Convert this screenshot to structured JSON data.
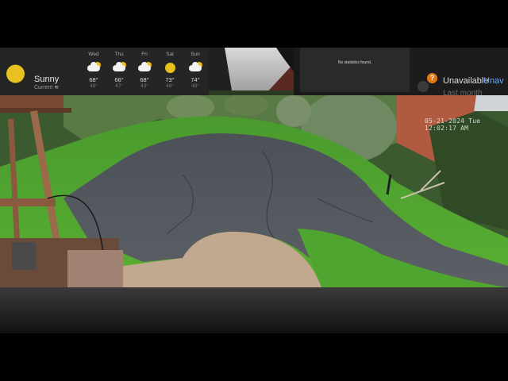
{
  "weather": {
    "current": {
      "condition": "Sunny",
      "label": "Current",
      "icon": "sun-icon",
      "wind_icon": "wind-icon"
    },
    "forecast": [
      {
        "day": "Wed",
        "high": "68°",
        "low": "48°",
        "icon": "partly-cloudy-icon"
      },
      {
        "day": "Thu",
        "high": "66°",
        "low": "47°",
        "icon": "partly-cloudy-icon"
      },
      {
        "day": "Fri",
        "high": "68°",
        "low": "43°",
        "icon": "partly-cloudy-icon"
      },
      {
        "day": "Sat",
        "high": "73°",
        "low": "46°",
        "icon": "sun-icon"
      },
      {
        "day": "Sun",
        "high": "74°",
        "low": "48°",
        "icon": "partly-cloudy-icon"
      }
    ]
  },
  "stats": {
    "message": "No statistics found."
  },
  "lock": {
    "badge": "?",
    "status": "Unavailable",
    "nav": "Unav",
    "period": "Last month",
    "icon": "lock-sensor-icon"
  },
  "camera": {
    "timestamp": "05-21-2024 Tue 12:02:17 AM"
  },
  "colors": {
    "accent": "#e8c020",
    "badge": "#e07a10",
    "link": "#6aa8ff"
  }
}
